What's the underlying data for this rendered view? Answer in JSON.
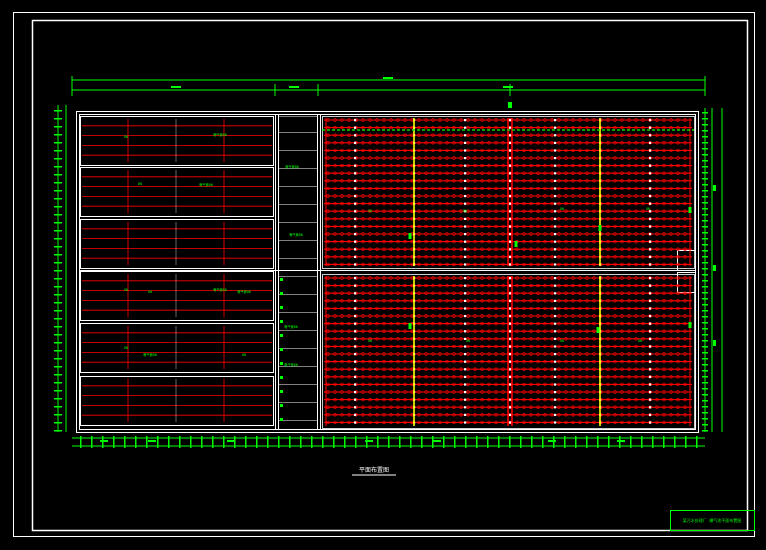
{
  "drawing": {
    "title": "平面布置图",
    "title_block_text": "某污水处理厂  曝气池平面布置图",
    "colors": {
      "background": "#000000",
      "frame": "#ffffff",
      "dimension": "#00ff00",
      "pipe": "#ff0000",
      "joint": "#ffff00",
      "annotation_text": "#00ff00"
    },
    "label_short": "DN",
    "label_long": "曝气管DN"
  }
}
